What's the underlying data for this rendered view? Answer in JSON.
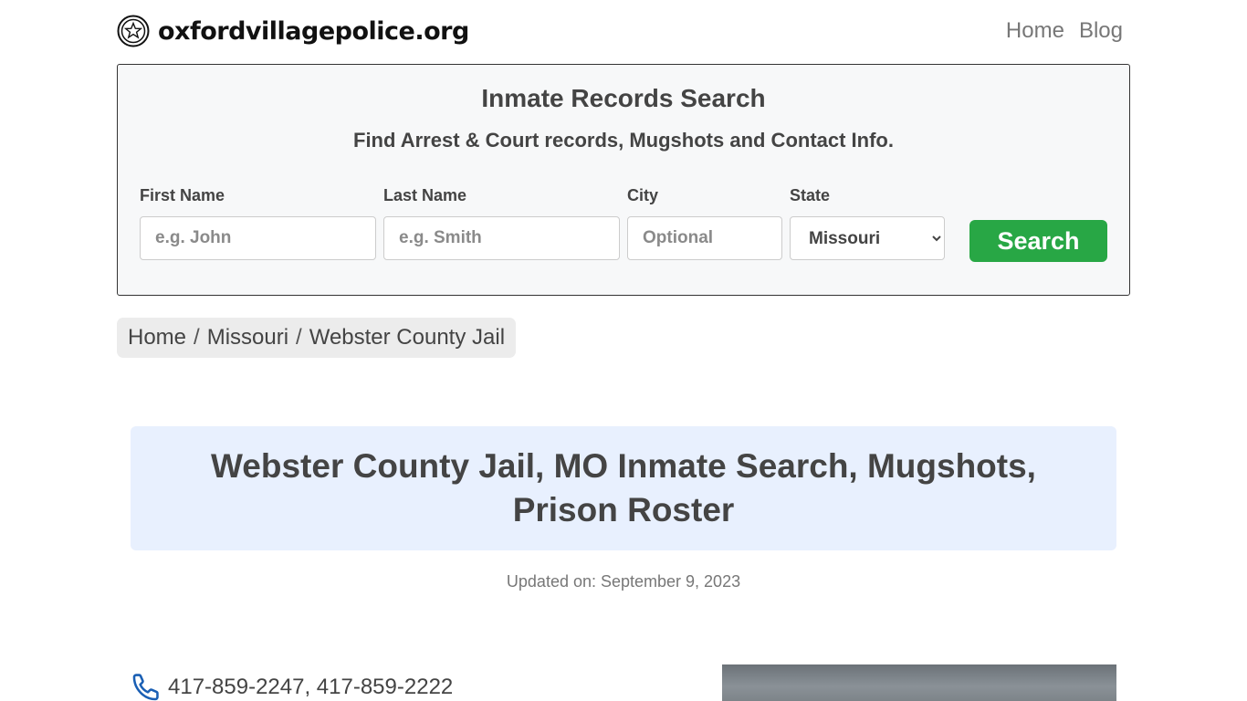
{
  "site": {
    "name": "oxfordvillagepolice.org"
  },
  "nav": {
    "items": [
      "Home",
      "Blog"
    ]
  },
  "search": {
    "title": "Inmate Records Search",
    "subtitle": "Find Arrest & Court records, Mugshots and Contact Info.",
    "first_name": {
      "label": "First Name",
      "placeholder": "e.g. John",
      "value": ""
    },
    "last_name": {
      "label": "Last Name",
      "placeholder": "e.g. Smith",
      "value": ""
    },
    "city": {
      "label": "City",
      "placeholder": "Optional",
      "value": ""
    },
    "state": {
      "label": "State",
      "selected": "Missouri"
    },
    "button_label": "Search"
  },
  "breadcrumb": {
    "items": [
      "Home",
      "Missouri",
      "Webster County Jail"
    ]
  },
  "page": {
    "title": "Webster County Jail, MO Inmate Search, Mugshots, Prison Roster",
    "updated": "Updated on: September 9, 2023"
  },
  "contact": {
    "phones": "417-859-2247, 417-859-2222"
  },
  "colors": {
    "search_button": "#28a745",
    "title_bg": "#e8f0fe",
    "phone_icon": "#1a5fb4"
  }
}
